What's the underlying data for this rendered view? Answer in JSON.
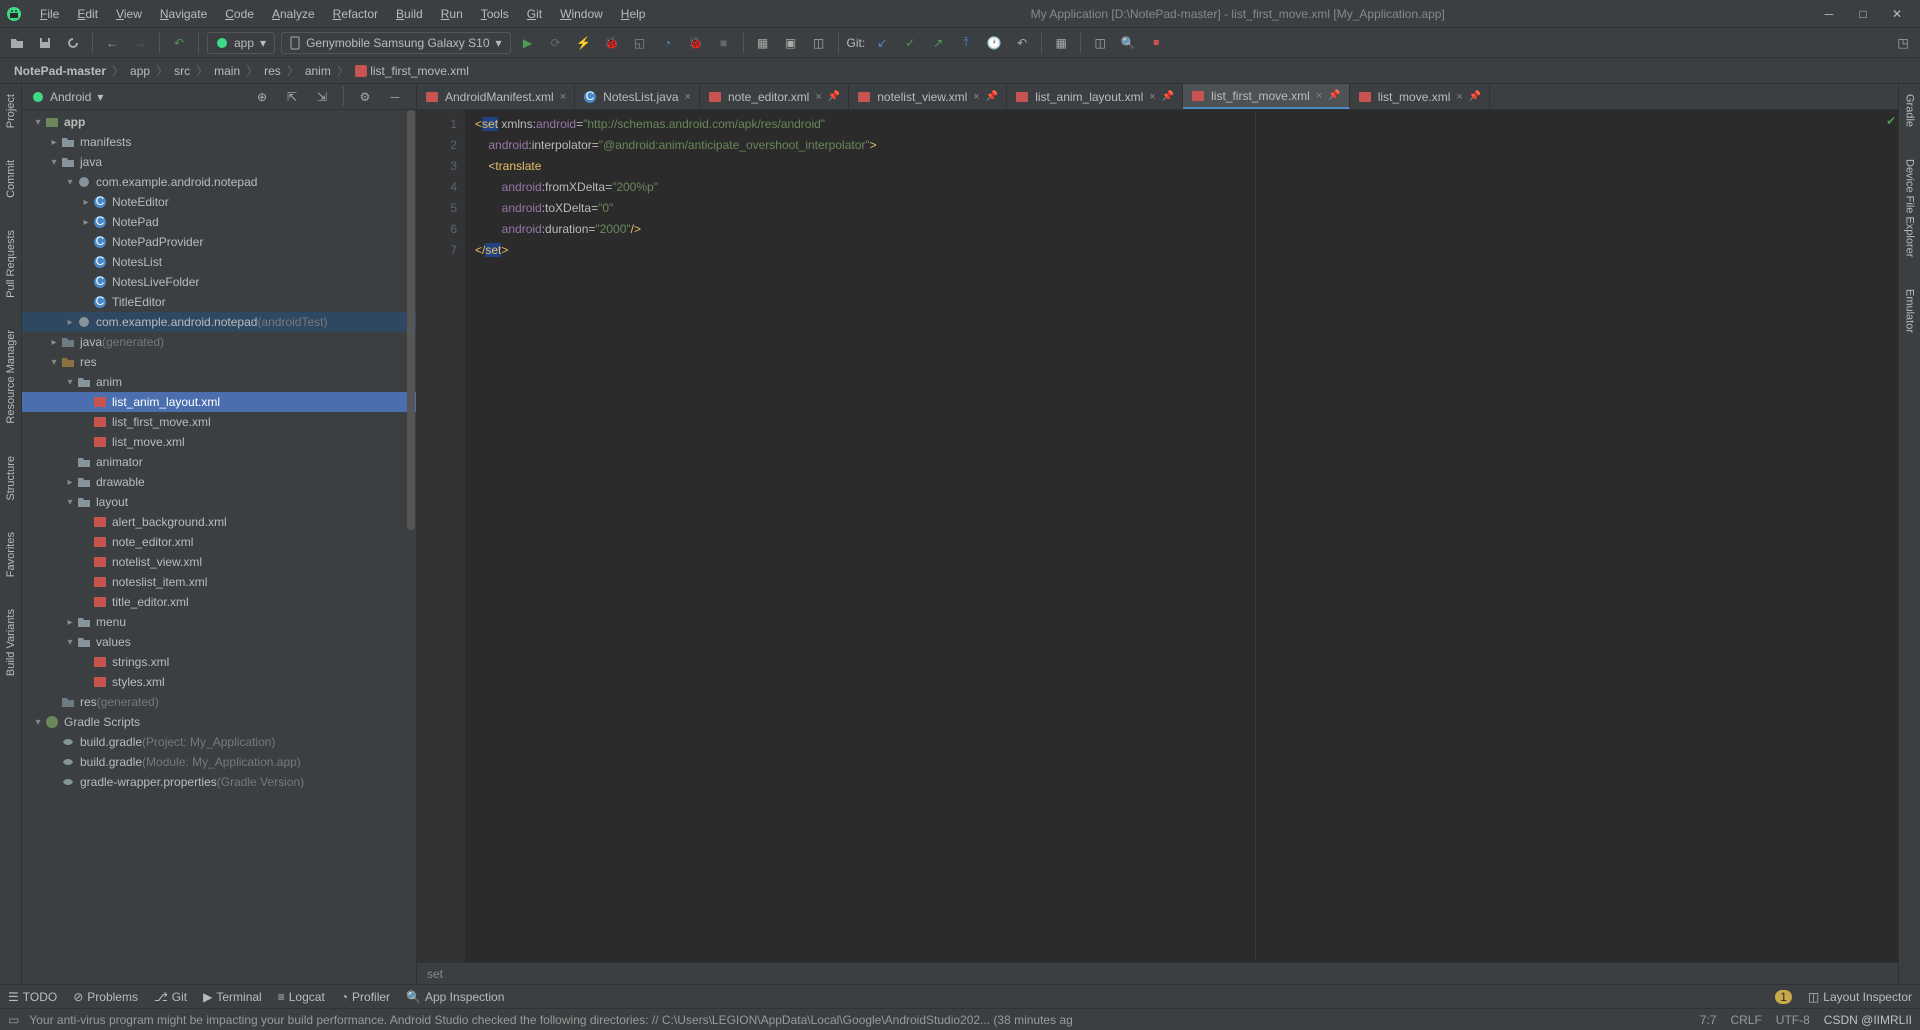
{
  "window": {
    "title": "My Application [D:\\NotePad-master] - list_first_move.xml [My_Application.app]"
  },
  "menu": [
    "File",
    "Edit",
    "View",
    "Navigate",
    "Code",
    "Analyze",
    "Refactor",
    "Build",
    "Run",
    "Tools",
    "Git",
    "Window",
    "Help"
  ],
  "toolbar": {
    "run_config": "app",
    "device": "Genymobile Samsung Galaxy S10",
    "git_label": "Git:"
  },
  "breadcrumbs": [
    "NotePad-master",
    "app",
    "src",
    "main",
    "res",
    "anim",
    "list_first_move.xml"
  ],
  "project": {
    "view_mode": "Android",
    "tree": [
      {
        "d": 0,
        "arrow": "v",
        "icon": "module",
        "label": "app",
        "bold": true
      },
      {
        "d": 1,
        "arrow": ">",
        "icon": "folder",
        "label": "manifests"
      },
      {
        "d": 1,
        "arrow": "v",
        "icon": "folder",
        "label": "java"
      },
      {
        "d": 2,
        "arrow": "v",
        "icon": "pkg",
        "label": "com.example.android.notepad"
      },
      {
        "d": 3,
        "arrow": ">",
        "icon": "class",
        "label": "NoteEditor"
      },
      {
        "d": 3,
        "arrow": ">",
        "icon": "class",
        "label": "NotePad"
      },
      {
        "d": 3,
        "arrow": "",
        "icon": "class",
        "label": "NotePadProvider"
      },
      {
        "d": 3,
        "arrow": "",
        "icon": "class",
        "label": "NotesList"
      },
      {
        "d": 3,
        "arrow": "",
        "icon": "class",
        "label": "NotesLiveFolder"
      },
      {
        "d": 3,
        "arrow": "",
        "icon": "class",
        "label": "TitleEditor"
      },
      {
        "d": 2,
        "arrow": ">",
        "icon": "pkg",
        "label": "com.example.android.notepad",
        "suffix": "(androidTest)",
        "hl": true
      },
      {
        "d": 1,
        "arrow": ">",
        "icon": "folder-gen",
        "label": "java",
        "suffix": "(generated)"
      },
      {
        "d": 1,
        "arrow": "v",
        "icon": "folder-res",
        "label": "res"
      },
      {
        "d": 2,
        "arrow": "v",
        "icon": "folder",
        "label": "anim"
      },
      {
        "d": 3,
        "arrow": "",
        "icon": "xml",
        "label": "list_anim_layout.xml",
        "sel": true
      },
      {
        "d": 3,
        "arrow": "",
        "icon": "xml",
        "label": "list_first_move.xml"
      },
      {
        "d": 3,
        "arrow": "",
        "icon": "xml",
        "label": "list_move.xml"
      },
      {
        "d": 2,
        "arrow": "",
        "icon": "folder",
        "label": "animator"
      },
      {
        "d": 2,
        "arrow": ">",
        "icon": "folder",
        "label": "drawable"
      },
      {
        "d": 2,
        "arrow": "v",
        "icon": "folder",
        "label": "layout"
      },
      {
        "d": 3,
        "arrow": "",
        "icon": "xml",
        "label": "alert_background.xml"
      },
      {
        "d": 3,
        "arrow": "",
        "icon": "xml",
        "label": "note_editor.xml"
      },
      {
        "d": 3,
        "arrow": "",
        "icon": "xml",
        "label": "notelist_view.xml"
      },
      {
        "d": 3,
        "arrow": "",
        "icon": "xml",
        "label": "noteslist_item.xml"
      },
      {
        "d": 3,
        "arrow": "",
        "icon": "xml",
        "label": "title_editor.xml"
      },
      {
        "d": 2,
        "arrow": ">",
        "icon": "folder",
        "label": "menu"
      },
      {
        "d": 2,
        "arrow": "v",
        "icon": "folder",
        "label": "values"
      },
      {
        "d": 3,
        "arrow": "",
        "icon": "xml",
        "label": "strings.xml"
      },
      {
        "d": 3,
        "arrow": "",
        "icon": "xml",
        "label": "styles.xml"
      },
      {
        "d": 1,
        "arrow": "",
        "icon": "folder-gen",
        "label": "res",
        "suffix": "(generated)"
      },
      {
        "d": 0,
        "arrow": "v",
        "icon": "gradle",
        "label": "Gradle Scripts"
      },
      {
        "d": 1,
        "arrow": "",
        "icon": "gradle-f",
        "label": "build.gradle",
        "suffix": "(Project: My_Application)"
      },
      {
        "d": 1,
        "arrow": "",
        "icon": "gradle-f",
        "label": "build.gradle",
        "suffix": "(Module: My_Application.app)"
      },
      {
        "d": 1,
        "arrow": "",
        "icon": "gradle-f",
        "label": "gradle-wrapper.properties",
        "suffix": "(Gradle Version)"
      }
    ]
  },
  "tabs": [
    {
      "icon": "xml",
      "label": "AndroidManifest.xml",
      "pin": false
    },
    {
      "icon": "class",
      "label": "NotesList.java",
      "pin": false
    },
    {
      "icon": "xml",
      "label": "note_editor.xml",
      "pin": true
    },
    {
      "icon": "xml",
      "label": "notelist_view.xml",
      "pin": true
    },
    {
      "icon": "xml",
      "label": "list_anim_layout.xml",
      "pin": true
    },
    {
      "icon": "xml",
      "label": "list_first_move.xml",
      "pin": true,
      "active": true
    },
    {
      "icon": "xml",
      "label": "list_move.xml",
      "pin": true
    }
  ],
  "code": {
    "lines": [
      1,
      2,
      3,
      4,
      5,
      6,
      7
    ],
    "l1_a": "<",
    "l1_b": "set",
    "l1_c": " xmlns:",
    "l1_d": "android",
    "l1_e": "=",
    "l1_f": "\"http://schemas.android.com/apk/res/android\"",
    "l2_a": "    ",
    "l2_b": "android",
    "l2_c": ":interpolator",
    "l2_d": "=",
    "l2_e": "\"@android:anim/anticipate_overshoot_interpolator\"",
    "l2_f": ">",
    "l3_a": "    <",
    "l3_b": "translate",
    "l4_a": "        ",
    "l4_b": "android",
    "l4_c": ":fromXDelta",
    "l4_d": "=",
    "l4_e": "\"200%p\"",
    "l5_a": "        ",
    "l5_b": "android",
    "l5_c": ":toXDelta",
    "l5_d": "=",
    "l5_e": "\"0\"",
    "l6_a": "        ",
    "l6_b": "android",
    "l6_c": ":duration",
    "l6_d": "=",
    "l6_e": "\"2000\"",
    "l6_f": "/>",
    "l7_a": "</",
    "l7_b": "set",
    "l7_c": ">"
  },
  "crumb_editor": "set",
  "left_tools": [
    "Project",
    "Commit",
    "Pull Requests",
    "Resource Manager",
    "Structure",
    "Favorites",
    "Build Variants"
  ],
  "right_tools": [
    "Gradle",
    "Device File Explorer",
    "Emulator"
  ],
  "bottom_tools": [
    "TODO",
    "Problems",
    "Git",
    "Terminal",
    "Logcat",
    "Profiler",
    "App Inspection"
  ],
  "bottom_right": [
    "Layout Inspector"
  ],
  "status": {
    "message": "Your anti-virus program might be impacting your build performance. Android Studio checked the following directories: // C:\\Users\\LEGION\\AppData\\Local\\Google\\AndroidStudio202... (38 minutes ag",
    "pos": "7:7",
    "line_sep": "CRLF",
    "encoding": "UTF-8",
    "watermark": "CSDN @IIMRLII",
    "badge": "1"
  }
}
